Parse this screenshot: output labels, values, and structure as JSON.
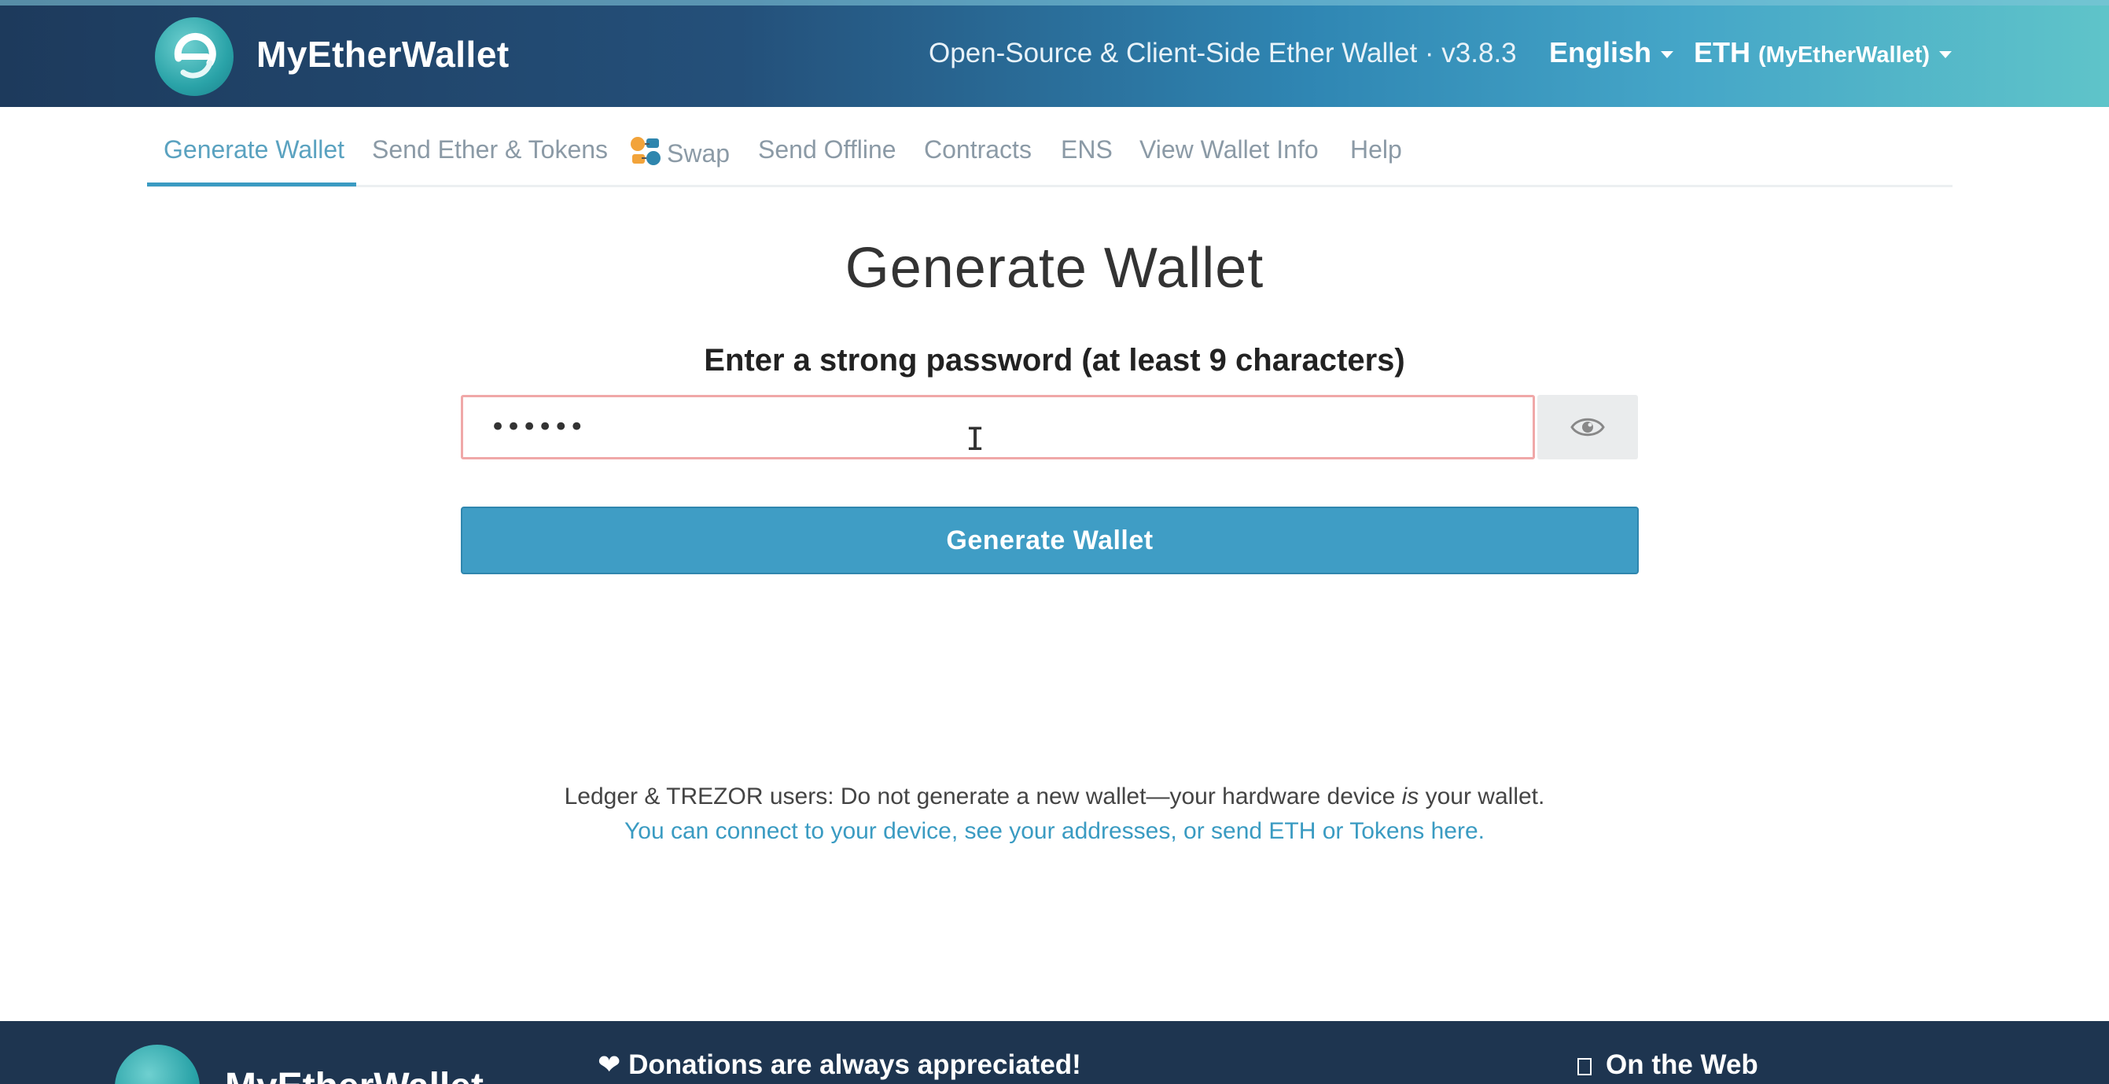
{
  "header": {
    "brand": "MyEtherWallet",
    "tagline": "Open-Source & Client-Side Ether Wallet · v3.8.3",
    "language": "English",
    "network_main": "ETH",
    "network_node": "(MyEtherWallet)"
  },
  "nav": {
    "items": [
      {
        "label": "Generate Wallet",
        "active": true
      },
      {
        "label": "Send Ether & Tokens"
      },
      {
        "label": "Swap",
        "icon": "swap-icon"
      },
      {
        "label": "Send Offline"
      },
      {
        "label": "Contracts"
      },
      {
        "label": "ENS"
      },
      {
        "label": "View Wallet Info"
      },
      {
        "label": "Help"
      }
    ]
  },
  "main": {
    "title": "Generate Wallet",
    "subtitle": "Enter a strong password (at least 9 characters)",
    "password_value": "••••••",
    "show_password_icon": "eye-icon",
    "generate_button": "Generate Wallet",
    "note_before": "Ledger & TREZOR users: Do not generate a new wallet—your hardware device ",
    "note_em": "is",
    "note_after": " your wallet.",
    "note_link": "You can connect to your device, see your addresses, or send ETH or Tokens here."
  },
  "footer": {
    "brand": "MyEtherWallet",
    "donations": "Donations are always appreciated!",
    "on_the_web": "On the Web"
  },
  "colors": {
    "accent": "#3f9dc5",
    "header_dark": "#1d3a5c",
    "header_light": "#5fc4c9",
    "input_error_border": "#f0a8a8",
    "footer_bg": "#1e3550"
  }
}
